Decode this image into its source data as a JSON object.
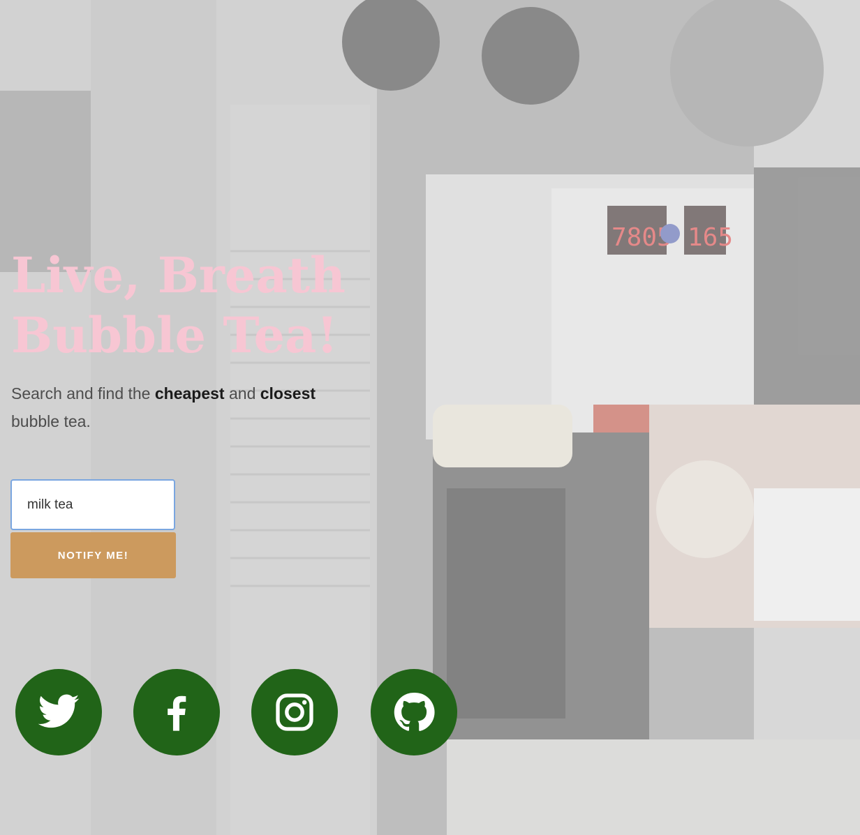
{
  "hero": {
    "headline_line1": "Live, Breath",
    "headline_line2": "Bubble Tea!",
    "subtitle_part1": "Search and find the ",
    "subtitle_bold1": "cheapest",
    "subtitle_part2": " and ",
    "subtitle_bold2": "closest",
    "subtitle_part3": " bubble tea."
  },
  "form": {
    "input_value": "milk tea",
    "button_label": "NOTIFY ME!"
  },
  "machine_display": {
    "counter": "7805",
    "right": "165"
  },
  "socials": [
    {
      "name": "twitter",
      "icon": "twitter-icon"
    },
    {
      "name": "facebook",
      "icon": "facebook-icon"
    },
    {
      "name": "instagram",
      "icon": "instagram-icon"
    },
    {
      "name": "github",
      "icon": "github-icon"
    }
  ],
  "colors": {
    "headline": "#f7c6d3",
    "button": "#cc9a5e",
    "social_bg": "#216418",
    "input_border": "#7aa6e0"
  }
}
